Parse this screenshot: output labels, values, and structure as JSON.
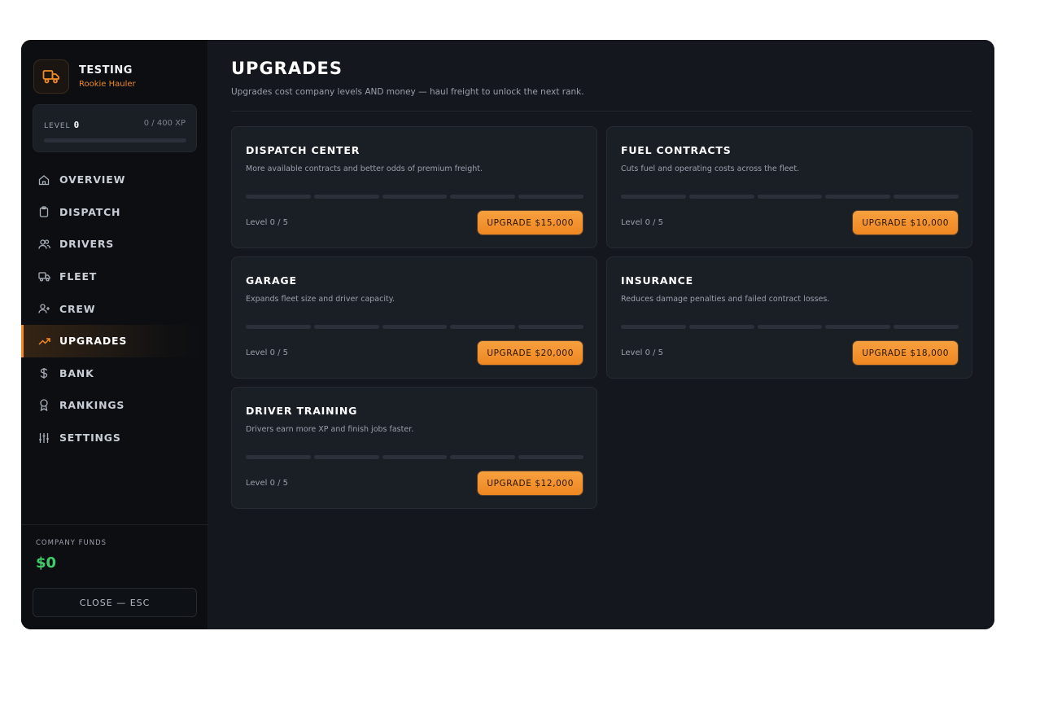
{
  "brand": {
    "title": "TESTING",
    "subtitle": "Rookie Hauler",
    "icon": "truck-icon"
  },
  "level": {
    "label": "LEVEL",
    "value": "0",
    "xp": "0 / 400 XP",
    "progress": 0
  },
  "nav": [
    {
      "label": "OVERVIEW",
      "icon": "home-icon"
    },
    {
      "label": "DISPATCH",
      "icon": "clipboard-icon"
    },
    {
      "label": "DRIVERS",
      "icon": "users-icon"
    },
    {
      "label": "FLEET",
      "icon": "truck-icon"
    },
    {
      "label": "CREW",
      "icon": "user-plus-icon"
    },
    {
      "label": "UPGRADES",
      "icon": "trending-up-icon",
      "active": true
    },
    {
      "label": "BANK",
      "icon": "dollar-icon"
    },
    {
      "label": "RANKINGS",
      "icon": "award-icon"
    },
    {
      "label": "SETTINGS",
      "icon": "sliders-icon"
    }
  ],
  "funds": {
    "label": "COMPANY FUNDS",
    "value": "$0"
  },
  "close_label": "CLOSE — ESC",
  "page": {
    "title": "UPGRADES",
    "subtitle": "Upgrades cost company levels AND money — haul freight to unlock the next rank."
  },
  "upgrades": [
    {
      "title": "DISPATCH CENTER",
      "desc": "More available contracts and better odds of premium freight.",
      "level": "Level 0 / 5",
      "progress": 0,
      "button": "UPGRADE $15,000"
    },
    {
      "title": "FUEL CONTRACTS",
      "desc": "Cuts fuel and operating costs across the fleet.",
      "level": "Level 0 / 5",
      "progress": 0,
      "button": "UPGRADE $10,000"
    },
    {
      "title": "GARAGE",
      "desc": "Expands fleet size and driver capacity.",
      "level": "Level 0 / 5",
      "progress": 0,
      "button": "UPGRADE $20,000"
    },
    {
      "title": "INSURANCE",
      "desc": "Reduces damage penalties and failed contract losses.",
      "level": "Level 0 / 5",
      "progress": 0,
      "button": "UPGRADE $18,000"
    },
    {
      "title": "DRIVER TRAINING",
      "desc": "Drivers earn more XP and finish jobs faster.",
      "level": "Level 0 / 5",
      "progress": 0,
      "button": "UPGRADE $12,000"
    }
  ],
  "colors": {
    "accent": "#f08a22",
    "funds": "#3ecf6b",
    "background": "#12151b"
  }
}
